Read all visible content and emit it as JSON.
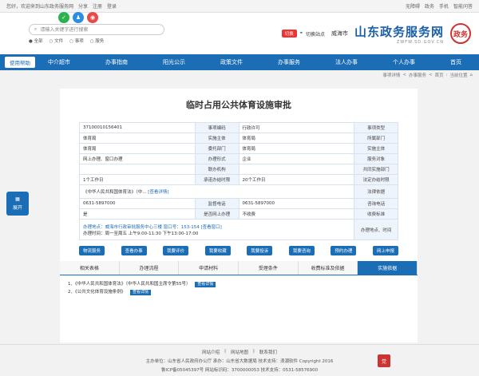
{
  "topbar": {
    "left": [
      "您好，欢迎来到山东政务服务网",
      "分享",
      "注册",
      "登录"
    ],
    "right": [
      "无障碍",
      "政务",
      "手机",
      "智能问答"
    ]
  },
  "header": {
    "search_placeholder": "请输入关键字进行搜索",
    "search_opts": [
      "全部",
      "文件",
      "事项",
      "服务"
    ],
    "region_tag": "切换",
    "city": "威海市",
    "switch_label": "切换站点",
    "logo_text": "山东政务服务网",
    "logo_sub": "ZWFW.SD.GOV.CN",
    "seal": "政务"
  },
  "nav": {
    "button": "使用帮助",
    "items": [
      "首页",
      "个人办事",
      "法人办事",
      "办事服务",
      "政策文件",
      "阳光公示",
      "办事指南",
      "中介超市"
    ]
  },
  "breadcrumb": [
    "当前位置",
    "首页",
    "办事服务",
    "事项详情"
  ],
  "main": {
    "title": "临时占用公共体育设施审批",
    "rows": [
      [
        "事项类型",
        "行政许可",
        "事项编码",
        "37100010156401"
      ],
      [
        "所属部门",
        "体育局",
        "实施主体",
        "体育局"
      ],
      [
        "实施主体",
        "体育局",
        "委托部门",
        "体育局"
      ],
      [
        "服务对象",
        "企业",
        "办理形式",
        "网上办理、窗口办理"
      ],
      [
        "共同实施部门",
        "",
        "联办机构",
        ""
      ],
      [
        "法定办结时限",
        "20个工作日",
        "承诺办结时限",
        "1个工作日"
      ],
      [
        "法律依据",
        "《中华人民共和国体育法》（中...",
        "",
        ""
      ],
      [
        "咨询电话",
        "0631-5897000",
        "监督电话",
        "0631-5897000"
      ],
      [
        "收费标准",
        "不收费",
        "是否网上办理",
        "是"
      ]
    ],
    "more_link": "[查看详情]",
    "address_label": "办理地点、时间",
    "address_text": "办理地点：威海市行政审批服务中心三楼 窗口号：153-154 [查看窗口]",
    "time_text": "办理时间：周一至周五 上午9:00-11:30 下午13:00-17:00",
    "actions": [
      "网上申报",
      "预约办理",
      "我要咨询",
      "我要投诉",
      "我要收藏",
      "我要评价",
      "查看办事",
      "物流服务"
    ],
    "tabs": [
      "实施依据",
      "受理条件",
      "申请材料",
      "办理流程",
      "相关表格",
      "收费标准及依据"
    ],
    "docs": [
      "1、《中华人民共和国体育法》（中华人民共和国主席令第55号）",
      "2、《公共文化体育设施条例》"
    ],
    "doc_link": "查看详情"
  },
  "side": {
    "label": "展开",
    "icon": "grid-icon"
  },
  "footer": {
    "links": [
      "网站介绍",
      "网站地图",
      "联系我们"
    ],
    "line1": "主办单位：山东省人民政府办公厅 承办：山东省大数据局 技术支持：浪潮软件 Copyright 2016",
    "line2": "鲁ICP备05045397号 网站标识码：3700000053 技术支持：0531-58576900",
    "badge": "党"
  },
  "colors": {
    "primary": "#1b6db6",
    "accent": "#e33",
    "share_green": "#2bb34f",
    "share_blue": "#2a8ee6",
    "share_red": "#e84a4a"
  }
}
